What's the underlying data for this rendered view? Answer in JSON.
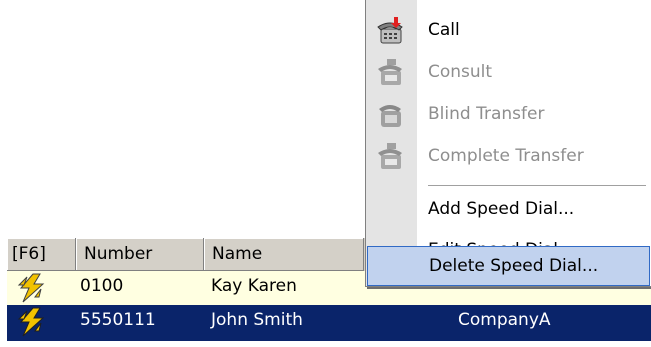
{
  "grid": {
    "columns": [
      "[F6]",
      "Number",
      "Name"
    ],
    "rows": [
      {
        "number": "0100",
        "name": "Kay Karen",
        "company": ""
      },
      {
        "number": "5550111",
        "name": "John Smith",
        "company": "CompanyA"
      }
    ],
    "colors": {
      "row_highlight": "#ffffe1",
      "row_selected": "#0a246a"
    }
  },
  "context_menu": {
    "items": [
      {
        "label": "Call",
        "icon": "phone-call-icon",
        "enabled": true
      },
      {
        "label": "Consult",
        "icon": "phone-consult-icon",
        "enabled": false
      },
      {
        "label": "Blind Transfer",
        "icon": "phone-blind-transfer-icon",
        "enabled": false
      },
      {
        "label": "Complete Transfer",
        "icon": "phone-complete-transfer-icon",
        "enabled": false
      },
      {
        "label": "Add Speed Dial...",
        "icon": "",
        "enabled": true
      },
      {
        "label": "Edit Speed Dial...",
        "icon": "",
        "enabled": true
      },
      {
        "label": "Delete Speed Dial...",
        "icon": "",
        "enabled": true,
        "highlighted": true
      }
    ],
    "colors": {
      "highlight_bg": "#c1d2ee",
      "highlight_border": "#316ac5",
      "disabled_text": "#8e8e8e"
    }
  }
}
